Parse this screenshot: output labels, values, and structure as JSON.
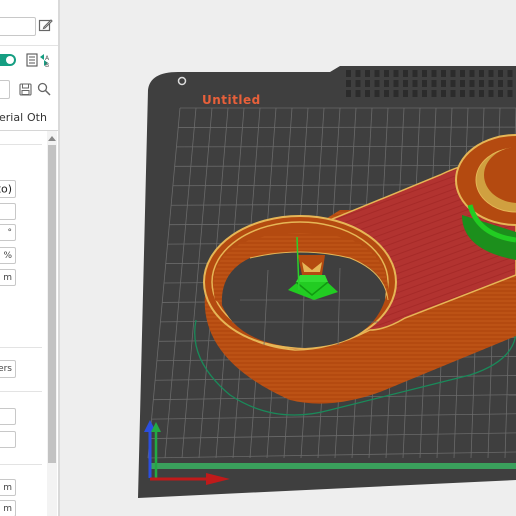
{
  "sidebar": {
    "tabs": [
      "erial",
      "Oth"
    ],
    "fields": {
      "f1_value": "to)",
      "f4_unit": "°",
      "f5_unit": "%",
      "f6_unit": "m",
      "layers_button": "ers",
      "f9_unit": "m",
      "f10_unit": "m"
    }
  },
  "plate": {
    "title": "Untitled"
  },
  "colors": {
    "accent": "#159e82",
    "plate": "#3f3f3f",
    "title": "#e8603a",
    "model_wall": "#b44a10",
    "model_top": "#b83331",
    "support": "#22cc22"
  }
}
